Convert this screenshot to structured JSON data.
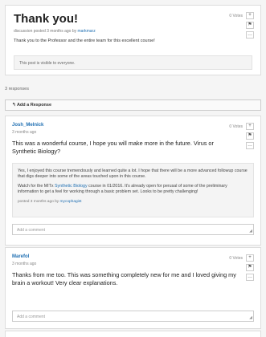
{
  "thread": {
    "title": "Thank you!",
    "meta_prefix": "discussion posted 3 months ago by",
    "author": "markmarz",
    "body": "Thank you to the Professor and the entire team for this excellent course!",
    "visibility": "This post is visible to everyone.",
    "votes": "0 Votes"
  },
  "responses_count": "3 responses",
  "add_response_label": "Add a Response",
  "comment_placeholder": "Add a comment",
  "responses": [
    {
      "author": "Josh_Melnick",
      "ago": "3 months ago",
      "votes": "0 Votes",
      "body": "This was a wonderful course, I hope you will make more in the future. Virus or Synthetic Biology?",
      "comment": {
        "p1": "Yes, I enjoyed this course tremendously and learned quite a lot. I hope that there will be a more advanced followup course that digs deeper into some of the areas touched upon in this course.",
        "p2_pre": "Watch for the MITx ",
        "p2_link": "Synthetic Biology",
        "p2_post": " course in 01/2016. It's already open for perusal of some of the preliminary information to get a feel for working through a basic problem set. Looks to be pretty challenging!",
        "by_prefix": "posted 3 months ago by",
        "by_user": "mycophagist"
      }
    },
    {
      "author": "Marefol",
      "ago": "3 months ago",
      "votes": "0 Votes",
      "body": "Thanks from me too. This was something completely new for me and I loved giving my brain a workout! Very clear explanations."
    }
  ],
  "icons": {
    "upvote": "+",
    "flag": "⚑",
    "more": "…",
    "reply": "↰",
    "resize": "◢"
  }
}
